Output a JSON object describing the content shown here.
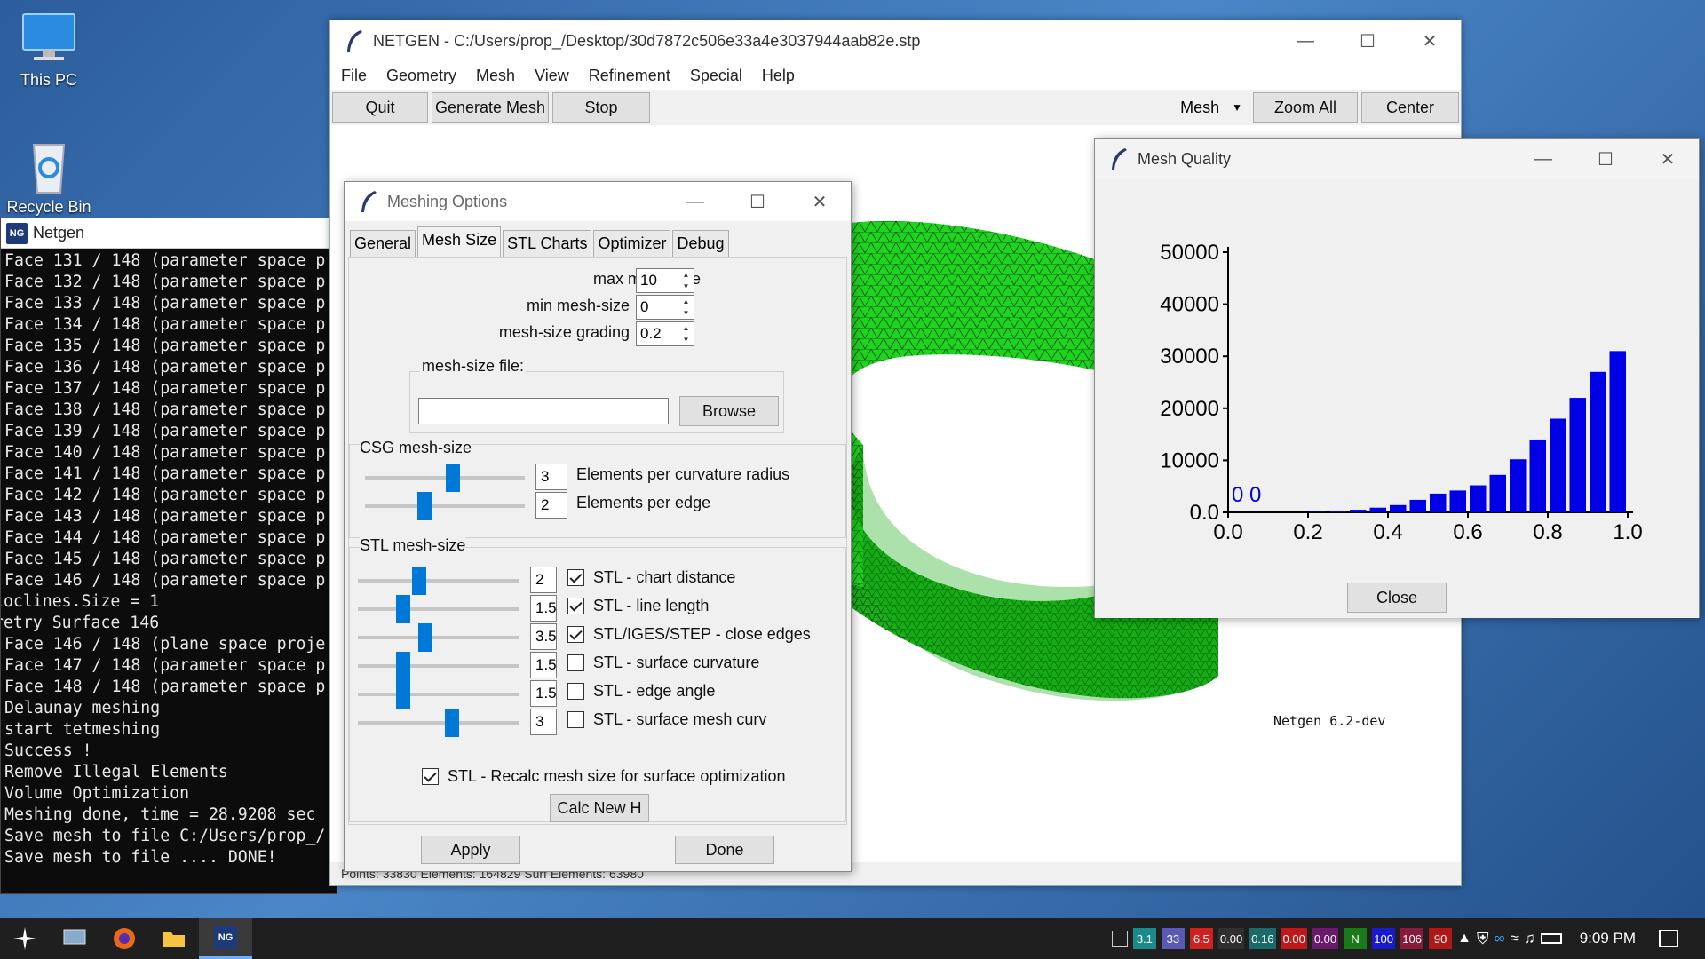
{
  "desktop": {
    "this_pc": "This PC",
    "recycle_bin": "Recycle Bin"
  },
  "console": {
    "title": "Netgen",
    "lines": [
      "Face 131 / 148 (parameter space p",
      "Face 132 / 148 (parameter space p",
      "Face 133 / 148 (parameter space p",
      "Face 134 / 148 (parameter space p",
      "Face 135 / 148 (parameter space p",
      "Face 136 / 148 (parameter space p",
      "Face 137 / 148 (parameter space p",
      "Face 138 / 148 (parameter space p",
      "Face 139 / 148 (parameter space p",
      "Face 140 / 148 (parameter space p",
      "Face 141 / 148 (parameter space p",
      "Face 142 / 148 (parameter space p",
      "Face 143 / 148 (parameter space p",
      "Face 144 / 148 (parameter space p",
      "Face 145 / 148 (parameter space p",
      "Face 146 / 148 (parameter space p",
      "loclines.Size = 1",
      "retry Surface 146",
      "Face 146 / 148 (plane space proje",
      "Face 147 / 148 (parameter space p",
      "Face 148 / 148 (parameter space p",
      "Delaunay meshing",
      "start tetmeshing",
      "Success !",
      "Remove Illegal Elements",
      "Volume Optimization",
      "Meshing done, time = 28.9208 sec",
      "Save mesh to file C:/Users/prop_/",
      "Save mesh to file .... DONE!"
    ]
  },
  "main": {
    "title": "NETGEN - C:/Users/prop_/Desktop/30d7872c506e33a4e3037944aab82e.stp",
    "menu": [
      "File",
      "Geometry",
      "Mesh",
      "View",
      "Refinement",
      "Special",
      "Help"
    ],
    "toolbar": {
      "quit": "Quit",
      "generate": "Generate Mesh",
      "stop": "Stop",
      "view_select": "Mesh",
      "zoom_all": "Zoom All",
      "center": "Center"
    },
    "version_label": "Netgen 6.2-dev",
    "status": "Points: 33830   Elements: 164829   Surf Elements: 63980"
  },
  "meshopts": {
    "title": "Meshing Options",
    "tabs": [
      "General",
      "Mesh Size",
      "STL Charts",
      "Optimizer",
      "Debug"
    ],
    "active_tab": "Mesh Size",
    "max_label": "max mesh-size",
    "max_val": "10",
    "min_label": "min mesh-size",
    "min_val": "0",
    "grading_label": "mesh-size grading",
    "grading_val": "0.2",
    "file_label": "mesh-size file:",
    "file_value": "",
    "browse": "Browse",
    "csg_label": "CSG mesh-size",
    "csg": [
      {
        "value": "3",
        "label": "Elements per curvature radius",
        "level": 0.55
      },
      {
        "value": "2",
        "label": "Elements per edge",
        "level": 0.37
      }
    ],
    "stl_label": "STL mesh-size",
    "stl": [
      {
        "value": "2",
        "label": "STL - chart distance",
        "checked": true,
        "level": 0.38
      },
      {
        "value": "1.5",
        "label": "STL - line length",
        "checked": true,
        "level": 0.28
      },
      {
        "value": "3.5",
        "label": "STL/IGES/STEP - close edges",
        "checked": true,
        "level": 0.42
      },
      {
        "value": "1.5",
        "label": "STL - surface curvature",
        "checked": false,
        "level": 0.28
      },
      {
        "value": "1.5",
        "label": "STL - edge angle",
        "checked": false,
        "level": 0.28
      },
      {
        "value": "3",
        "label": "STL - surface mesh curv",
        "checked": false,
        "level": 0.58
      }
    ],
    "recalc_label": "STL - Recalc mesh size for surface optimization",
    "recalc_checked": true,
    "calc_new_h": "Calc New H",
    "apply": "Apply",
    "done": "Done"
  },
  "quality": {
    "title": "Mesh Quality",
    "close": "Close"
  },
  "chart_data": {
    "type": "bar",
    "x": [
      0.025,
      0.075,
      0.125,
      0.175,
      0.225,
      0.275,
      0.325,
      0.375,
      0.425,
      0.475,
      0.525,
      0.575,
      0.625,
      0.675,
      0.725,
      0.775,
      0.825,
      0.875,
      0.925,
      0.975
    ],
    "values": [
      0,
      0,
      0,
      0,
      100,
      300,
      500,
      900,
      1400,
      2400,
      3600,
      4200,
      5200,
      7200,
      10200,
      14000,
      18000,
      22000,
      27000,
      31000
    ],
    "annotation": "0 0",
    "ylim": [
      0,
      50000
    ],
    "xlim": [
      0.0,
      1.0
    ],
    "yticks": [
      "0.0",
      "10000",
      "20000",
      "30000",
      "40000",
      "50000"
    ],
    "xticks": [
      "0.0",
      "0.2",
      "0.4",
      "0.6",
      "0.8",
      "1.0"
    ],
    "bar_color": "#0000e6",
    "grid": false
  },
  "taskbar": {
    "time": "9:09 PM",
    "tray": [
      {
        "text": "3.1",
        "color": "#1a8a8a"
      },
      {
        "text": "33",
        "color": "#5a5ab4"
      },
      {
        "text": "6.5",
        "color": "#d02020"
      },
      {
        "text": "0.00",
        "color": "#303030"
      },
      {
        "text": "0.16",
        "color": "#1a6a6a"
      },
      {
        "text": "0.00",
        "color": "#c01818"
      },
      {
        "text": "0.00",
        "color": "#6a1a6a"
      },
      {
        "text": "N",
        "color": "#1a7a1a"
      },
      {
        "text": "100",
        "color": "#1a1acc"
      },
      {
        "text": "106",
        "color": "#8a1a3a"
      },
      {
        "text": "90",
        "color": "#b01818"
      }
    ]
  }
}
